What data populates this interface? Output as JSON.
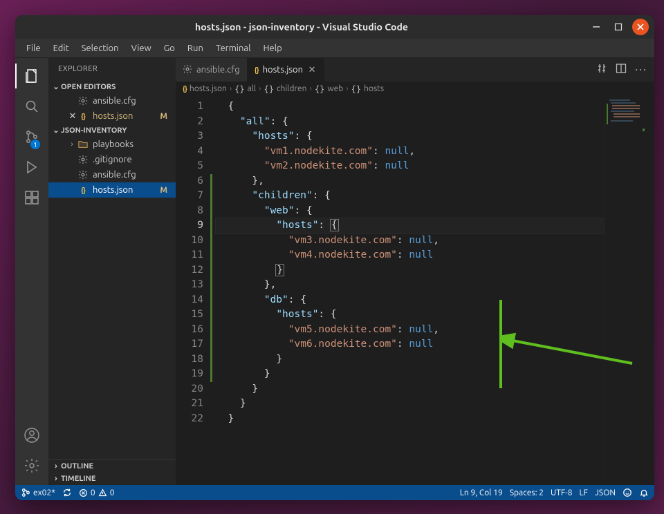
{
  "window": {
    "title": "hosts.json - json-inventory - Visual Studio Code"
  },
  "menu": [
    "File",
    "Edit",
    "Selection",
    "View",
    "Go",
    "Run",
    "Terminal",
    "Help"
  ],
  "activity": {
    "scm_badge": "1"
  },
  "explorer": {
    "title": "EXPLORER",
    "open_editors_hdr": "OPEN EDITORS",
    "open_editors": [
      {
        "label": "ansible.cfg",
        "kind": "gear",
        "mod": ""
      },
      {
        "label": "hosts.json",
        "kind": "json",
        "mod": "M",
        "pre": "✕"
      }
    ],
    "folder_hdr": "JSON-INVENTORY",
    "tree": [
      {
        "label": "playbooks",
        "kind": "folder",
        "chev": "›"
      },
      {
        "label": ".gitignore",
        "kind": "gear"
      },
      {
        "label": "ansible.cfg",
        "kind": "gear"
      },
      {
        "label": "hosts.json",
        "kind": "json",
        "mod": "M",
        "sel": true
      }
    ],
    "outline": "OUTLINE",
    "timeline": "TIMELINE"
  },
  "tabs": [
    {
      "label": "ansible.cfg",
      "kind": "gear"
    },
    {
      "label": "hosts.json",
      "kind": "json",
      "active": true
    }
  ],
  "breadcrumbs": [
    {
      "label": "hosts.json",
      "icon": "json"
    },
    {
      "label": "all",
      "icon": "brace"
    },
    {
      "label": "children",
      "icon": "brace"
    },
    {
      "label": "web",
      "icon": "brace"
    },
    {
      "label": "hosts",
      "icon": "brace"
    }
  ],
  "code": {
    "lines": [
      {
        "n": 1,
        "ind": 1,
        "seg": [
          [
            "p",
            "{"
          ]
        ]
      },
      {
        "n": 2,
        "ind": 2,
        "seg": [
          [
            "k",
            "\"all\""
          ],
          [
            "p",
            ": {"
          ]
        ]
      },
      {
        "n": 3,
        "ind": 3,
        "seg": [
          [
            "k",
            "\"hosts\""
          ],
          [
            "p",
            ": {"
          ]
        ]
      },
      {
        "n": 4,
        "ind": 4,
        "seg": [
          [
            "s",
            "\"vm1.nodekite.com\""
          ],
          [
            "p",
            ": "
          ],
          [
            "n",
            "null"
          ],
          [
            "p",
            ","
          ]
        ]
      },
      {
        "n": 5,
        "ind": 4,
        "seg": [
          [
            "s",
            "\"vm2.nodekite.com\""
          ],
          [
            "p",
            ": "
          ],
          [
            "n",
            "null"
          ]
        ]
      },
      {
        "n": 6,
        "ind": 3,
        "seg": [
          [
            "p",
            "},"
          ]
        ],
        "diff": true
      },
      {
        "n": 7,
        "ind": 3,
        "seg": [
          [
            "k",
            "\"children\""
          ],
          [
            "p",
            ": {"
          ]
        ],
        "diff": true
      },
      {
        "n": 8,
        "ind": 4,
        "seg": [
          [
            "k",
            "\"web\""
          ],
          [
            "p",
            ": {"
          ]
        ],
        "diff": true
      },
      {
        "n": 9,
        "ind": 5,
        "seg": [
          [
            "k",
            "\"hosts\""
          ],
          [
            "p",
            ": "
          ],
          [
            "cb",
            "{"
          ]
        ],
        "diff": true,
        "current": true
      },
      {
        "n": 10,
        "ind": 6,
        "seg": [
          [
            "s",
            "\"vm3.nodekite.com\""
          ],
          [
            "p",
            ": "
          ],
          [
            "n",
            "null"
          ],
          [
            "p",
            ","
          ]
        ],
        "diff": true
      },
      {
        "n": 11,
        "ind": 6,
        "seg": [
          [
            "s",
            "\"vm4.nodekite.com\""
          ],
          [
            "p",
            ": "
          ],
          [
            "n",
            "null"
          ]
        ],
        "diff": true
      },
      {
        "n": 12,
        "ind": 5,
        "seg": [
          [
            "cb",
            "}"
          ]
        ],
        "diff": true
      },
      {
        "n": 13,
        "ind": 4,
        "seg": [
          [
            "p",
            "},"
          ]
        ],
        "diff": true
      },
      {
        "n": 14,
        "ind": 4,
        "seg": [
          [
            "k",
            "\"db\""
          ],
          [
            "p",
            ": {"
          ]
        ],
        "diff": true
      },
      {
        "n": 15,
        "ind": 5,
        "seg": [
          [
            "k",
            "\"hosts\""
          ],
          [
            "p",
            ": {"
          ]
        ],
        "diff": true
      },
      {
        "n": 16,
        "ind": 6,
        "seg": [
          [
            "s",
            "\"vm5.nodekite.com\""
          ],
          [
            "p",
            ": "
          ],
          [
            "n",
            "null"
          ],
          [
            "p",
            ","
          ]
        ],
        "diff": true
      },
      {
        "n": 17,
        "ind": 6,
        "seg": [
          [
            "s",
            "\"vm6.nodekite.com\""
          ],
          [
            "p",
            ": "
          ],
          [
            "n",
            "null"
          ]
        ],
        "diff": true
      },
      {
        "n": 18,
        "ind": 5,
        "seg": [
          [
            "p",
            "}"
          ]
        ],
        "diff": true
      },
      {
        "n": 19,
        "ind": 4,
        "seg": [
          [
            "p",
            "}"
          ]
        ],
        "diff": true
      },
      {
        "n": 20,
        "ind": 3,
        "seg": [
          [
            "p",
            "}"
          ]
        ]
      },
      {
        "n": 21,
        "ind": 2,
        "seg": [
          [
            "p",
            "}"
          ]
        ]
      },
      {
        "n": 22,
        "ind": 1,
        "seg": [
          [
            "p",
            "}"
          ]
        ]
      }
    ]
  },
  "status": {
    "remote": "ex02*",
    "sync": "",
    "problems": "0",
    "warnings": "0",
    "lncol": "Ln 9, Col 19",
    "spaces": "Spaces: 2",
    "enc": "UTF-8",
    "eol": "LF",
    "lang": "JSON"
  }
}
